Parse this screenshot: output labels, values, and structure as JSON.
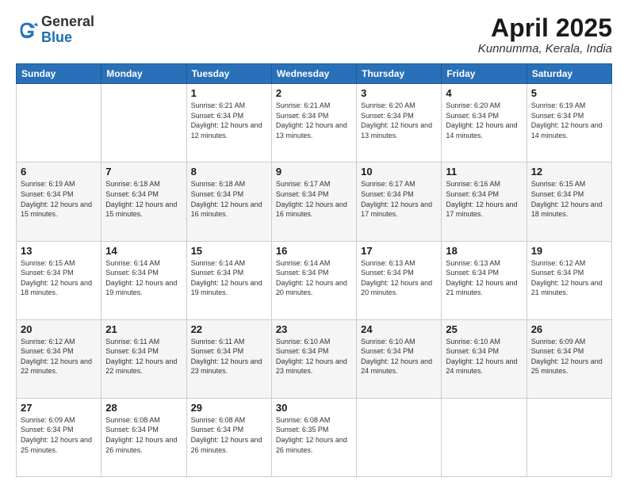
{
  "header": {
    "logo_general": "General",
    "logo_blue": "Blue",
    "title": "April 2025",
    "subtitle": "Kunnumma, Kerala, India"
  },
  "calendar": {
    "headers": [
      "Sunday",
      "Monday",
      "Tuesday",
      "Wednesday",
      "Thursday",
      "Friday",
      "Saturday"
    ],
    "weeks": [
      [
        {
          "day": "",
          "info": ""
        },
        {
          "day": "",
          "info": ""
        },
        {
          "day": "1",
          "info": "Sunrise: 6:21 AM\nSunset: 6:34 PM\nDaylight: 12 hours and 12 minutes."
        },
        {
          "day": "2",
          "info": "Sunrise: 6:21 AM\nSunset: 6:34 PM\nDaylight: 12 hours and 13 minutes."
        },
        {
          "day": "3",
          "info": "Sunrise: 6:20 AM\nSunset: 6:34 PM\nDaylight: 12 hours and 13 minutes."
        },
        {
          "day": "4",
          "info": "Sunrise: 6:20 AM\nSunset: 6:34 PM\nDaylight: 12 hours and 14 minutes."
        },
        {
          "day": "5",
          "info": "Sunrise: 6:19 AM\nSunset: 6:34 PM\nDaylight: 12 hours and 14 minutes."
        }
      ],
      [
        {
          "day": "6",
          "info": "Sunrise: 6:19 AM\nSunset: 6:34 PM\nDaylight: 12 hours and 15 minutes."
        },
        {
          "day": "7",
          "info": "Sunrise: 6:18 AM\nSunset: 6:34 PM\nDaylight: 12 hours and 15 minutes."
        },
        {
          "day": "8",
          "info": "Sunrise: 6:18 AM\nSunset: 6:34 PM\nDaylight: 12 hours and 16 minutes."
        },
        {
          "day": "9",
          "info": "Sunrise: 6:17 AM\nSunset: 6:34 PM\nDaylight: 12 hours and 16 minutes."
        },
        {
          "day": "10",
          "info": "Sunrise: 6:17 AM\nSunset: 6:34 PM\nDaylight: 12 hours and 17 minutes."
        },
        {
          "day": "11",
          "info": "Sunrise: 6:16 AM\nSunset: 6:34 PM\nDaylight: 12 hours and 17 minutes."
        },
        {
          "day": "12",
          "info": "Sunrise: 6:15 AM\nSunset: 6:34 PM\nDaylight: 12 hours and 18 minutes."
        }
      ],
      [
        {
          "day": "13",
          "info": "Sunrise: 6:15 AM\nSunset: 6:34 PM\nDaylight: 12 hours and 18 minutes."
        },
        {
          "day": "14",
          "info": "Sunrise: 6:14 AM\nSunset: 6:34 PM\nDaylight: 12 hours and 19 minutes."
        },
        {
          "day": "15",
          "info": "Sunrise: 6:14 AM\nSunset: 6:34 PM\nDaylight: 12 hours and 19 minutes."
        },
        {
          "day": "16",
          "info": "Sunrise: 6:14 AM\nSunset: 6:34 PM\nDaylight: 12 hours and 20 minutes."
        },
        {
          "day": "17",
          "info": "Sunrise: 6:13 AM\nSunset: 6:34 PM\nDaylight: 12 hours and 20 minutes."
        },
        {
          "day": "18",
          "info": "Sunrise: 6:13 AM\nSunset: 6:34 PM\nDaylight: 12 hours and 21 minutes."
        },
        {
          "day": "19",
          "info": "Sunrise: 6:12 AM\nSunset: 6:34 PM\nDaylight: 12 hours and 21 minutes."
        }
      ],
      [
        {
          "day": "20",
          "info": "Sunrise: 6:12 AM\nSunset: 6:34 PM\nDaylight: 12 hours and 22 minutes."
        },
        {
          "day": "21",
          "info": "Sunrise: 6:11 AM\nSunset: 6:34 PM\nDaylight: 12 hours and 22 minutes."
        },
        {
          "day": "22",
          "info": "Sunrise: 6:11 AM\nSunset: 6:34 PM\nDaylight: 12 hours and 23 minutes."
        },
        {
          "day": "23",
          "info": "Sunrise: 6:10 AM\nSunset: 6:34 PM\nDaylight: 12 hours and 23 minutes."
        },
        {
          "day": "24",
          "info": "Sunrise: 6:10 AM\nSunset: 6:34 PM\nDaylight: 12 hours and 24 minutes."
        },
        {
          "day": "25",
          "info": "Sunrise: 6:10 AM\nSunset: 6:34 PM\nDaylight: 12 hours and 24 minutes."
        },
        {
          "day": "26",
          "info": "Sunrise: 6:09 AM\nSunset: 6:34 PM\nDaylight: 12 hours and 25 minutes."
        }
      ],
      [
        {
          "day": "27",
          "info": "Sunrise: 6:09 AM\nSunset: 6:34 PM\nDaylight: 12 hours and 25 minutes."
        },
        {
          "day": "28",
          "info": "Sunrise: 6:08 AM\nSunset: 6:34 PM\nDaylight: 12 hours and 26 minutes."
        },
        {
          "day": "29",
          "info": "Sunrise: 6:08 AM\nSunset: 6:34 PM\nDaylight: 12 hours and 26 minutes."
        },
        {
          "day": "30",
          "info": "Sunrise: 6:08 AM\nSunset: 6:35 PM\nDaylight: 12 hours and 26 minutes."
        },
        {
          "day": "",
          "info": ""
        },
        {
          "day": "",
          "info": ""
        },
        {
          "day": "",
          "info": ""
        }
      ]
    ]
  }
}
